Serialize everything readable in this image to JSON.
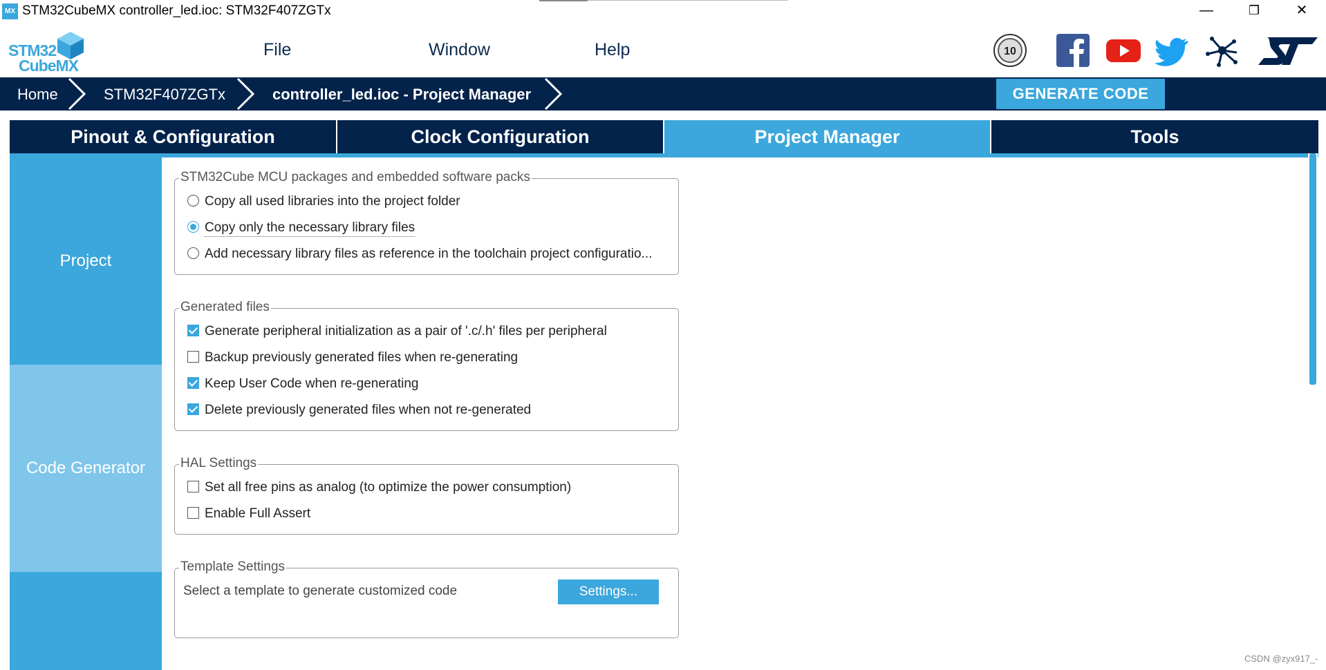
{
  "window": {
    "icon_text": "MX",
    "title": "STM32CubeMX controller_led.ioc: STM32F407ZGTx",
    "minimize": "—",
    "restore": "❐",
    "close": "✕"
  },
  "logo": {
    "line1": "STM32",
    "line2": "CubeMX"
  },
  "menu": {
    "file": "File",
    "window": "Window",
    "help": "Help"
  },
  "social": [
    "10-years-badge-icon",
    "facebook-icon",
    "youtube-icon",
    "twitter-icon",
    "network-icon",
    "st-logo-icon"
  ],
  "breadcrumb": {
    "home": "Home",
    "mcu": "STM32F407ZGTx",
    "project": "controller_led.ioc - Project Manager"
  },
  "generate_button": "GENERATE CODE",
  "tabs": [
    "Pinout & Configuration",
    "Clock Configuration",
    "Project Manager",
    "Tools"
  ],
  "active_tab": "Project Manager",
  "sidebar": {
    "project": "Project",
    "code_generator": "Code Generator"
  },
  "packages": {
    "legend": "STM32Cube MCU packages and embedded software packs",
    "opt1": "Copy all used libraries into the project folder",
    "opt2": "Copy only the necessary library files",
    "opt3": "Add necessary library files as reference in the toolchain project configuratio..."
  },
  "generated": {
    "legend": "Generated files",
    "opt1": "Generate peripheral initialization as a pair of '.c/.h' files per peripheral",
    "opt2": "Backup previously generated files when re-generating",
    "opt3": "Keep User Code when re-generating",
    "opt4": "Delete previously generated files when not re-generated"
  },
  "hal": {
    "legend": "HAL Settings",
    "opt1": "Set all free pins as analog (to optimize the power consumption)",
    "opt2": "Enable Full Assert"
  },
  "template": {
    "legend": "Template Settings",
    "text": "Select a template to generate customized code",
    "button": "Settings..."
  },
  "watermark": "CSDN @zyx917_-",
  "colors": {
    "navy": "#03234b",
    "accent": "#3ba7dc",
    "sidebar_selected": "#7fc6ea"
  }
}
